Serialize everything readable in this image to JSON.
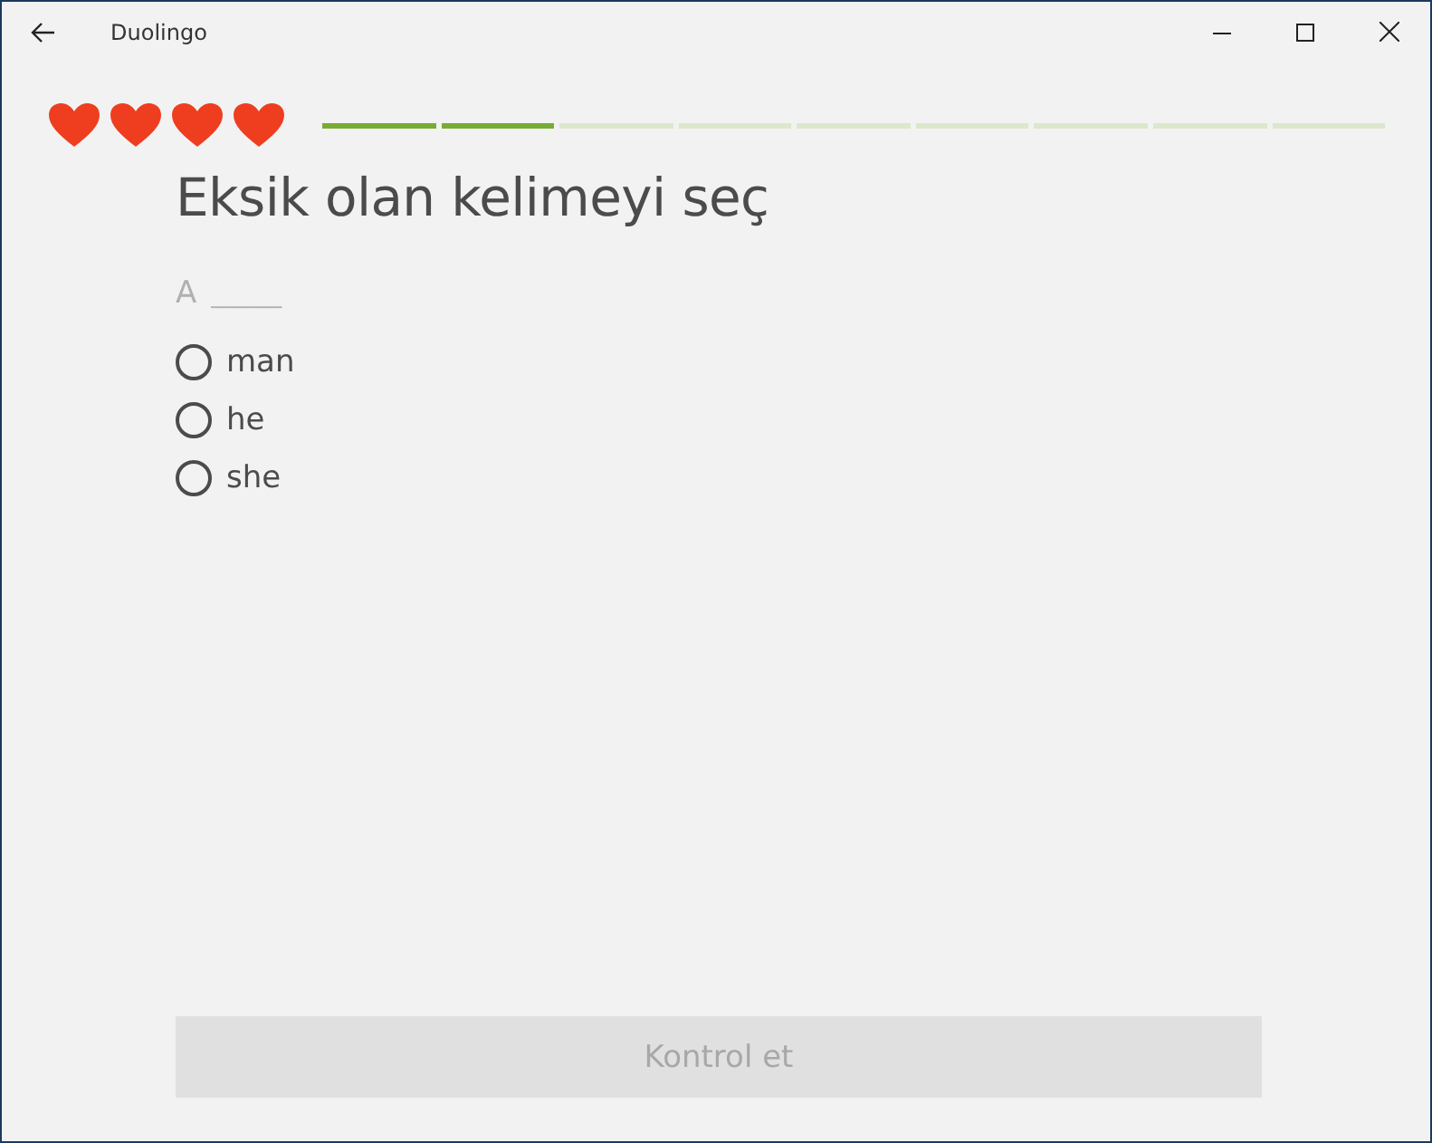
{
  "window": {
    "title": "Duolingo"
  },
  "lives": [
    {
      "full": true
    },
    {
      "full": true
    },
    {
      "full": true
    },
    {
      "full": true
    }
  ],
  "progress": [
    {
      "completed": true
    },
    {
      "completed": true
    },
    {
      "completed": false
    },
    {
      "completed": false
    },
    {
      "completed": false
    },
    {
      "completed": false
    },
    {
      "completed": false
    },
    {
      "completed": false
    },
    {
      "completed": false
    }
  ],
  "prompt": "Eksik olan kelimeyi seç",
  "sentence": {
    "word": "A",
    "blank": "______"
  },
  "options": [
    {
      "label": "man",
      "selected": false
    },
    {
      "label": "he",
      "selected": false
    },
    {
      "label": "she",
      "selected": false
    }
  ],
  "check_button": {
    "label": "Kontrol et",
    "disabled": true
  }
}
